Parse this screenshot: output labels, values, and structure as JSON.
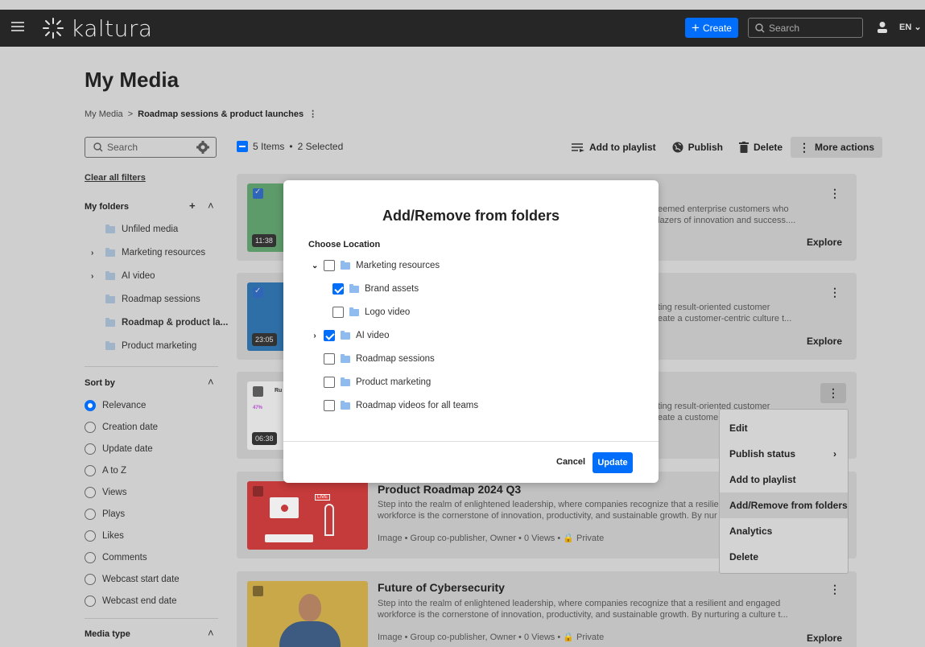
{
  "app": {
    "brand": "kaltura",
    "create_label": "Create",
    "search_placeholder": "Search",
    "language": "EN"
  },
  "page": {
    "title": "My Media"
  },
  "breadcrumb": {
    "root": "My Media",
    "separator": ">",
    "current": "Roadmap sessions & product launches",
    "menu": "⋮"
  },
  "toolbar": {
    "search_placeholder": "Search",
    "items_count": "5 Items",
    "bullet": "•",
    "selected": "2 Selected",
    "add_to_playlist": "Add to playlist",
    "publish": "Publish",
    "delete": "Delete",
    "more_actions": "More actions"
  },
  "sidebar": {
    "clear_filters": "Clear all filters",
    "my_folders": "My folders",
    "folders": [
      {
        "label": "Unfiled media",
        "expandable": false,
        "bold": false
      },
      {
        "label": "Marketing resources",
        "expandable": true,
        "bold": false
      },
      {
        "label": "AI video",
        "expandable": true,
        "bold": false
      },
      {
        "label": "Roadmap sessions",
        "expandable": false,
        "bold": false
      },
      {
        "label": "Roadmap & product la...",
        "expandable": false,
        "bold": true
      },
      {
        "label": "Product marketing",
        "expandable": false,
        "bold": false
      }
    ],
    "sort_by": "Sort by",
    "sort_options": [
      "Relevance",
      "Creation date",
      "Update date",
      "A to Z",
      "Views",
      "Plays",
      "Likes",
      "Comments",
      "Webcast start date",
      "Webcast end date"
    ],
    "sort_selected": "Relevance",
    "media_type": "Media type"
  },
  "cards": [
    {
      "duration": "11:38",
      "checked": true,
      "desc_line1": "eemed enterprise customers who",
      "desc_line2": "lazers of innovation and success....",
      "explore": "Explore",
      "thumb_color": "#5e9b6a"
    },
    {
      "duration": "23:05",
      "checked": true,
      "desc_line1": "ting result-oriented customer",
      "desc_line2": "eate a customer-centric culture t...",
      "explore": "Explore",
      "thumb_color": "#2f6fa8"
    },
    {
      "duration": "06:38",
      "checked": false,
      "desc_line1": "ting result-oriented customer",
      "desc_line2": "eate a custome",
      "explore": "",
      "thumb_color": "#e8e8e8",
      "thumb_label": "Ru",
      "thumb_stat": "47%"
    },
    {
      "title": "Product Roadmap 2024 Q3",
      "desc_line1": "Step into the realm of enlightened leadership, where companies recognize that a resilier",
      "desc_line2": "workforce is the cornerstone of innovation, productivity, and sustainable growth. By nur",
      "meta": "Image  •  Group co-publisher, Owner  •  0 Views  •  🔒 Private",
      "thumb_color": "#c53a3a",
      "thumb_badge": "LIVE"
    },
    {
      "title": "Future of Cybersecurity",
      "desc_line1": "Step into the realm of enlightened leadership, where companies recognize that a resilient and engaged",
      "desc_line2": "workforce is the cornerstone of innovation, productivity, and sustainable growth. By nurturing a culture t...",
      "meta": "Image  •  Group co-publisher, Owner  •  0 Views  •  🔒 Private",
      "explore": "Explore",
      "thumb_color": "#c9a84a"
    }
  ],
  "context_menu": {
    "items": [
      "Edit",
      "Publish status",
      "Add to playlist",
      "Add/Remove from folders",
      "Analytics",
      "Delete"
    ],
    "highlighted": "Add/Remove from folders"
  },
  "modal": {
    "title": "Add/Remove from folders",
    "subtitle": "Choose Location",
    "tree": [
      {
        "label": "Marketing resources",
        "level": 0,
        "chevron": "expanded",
        "checked": false
      },
      {
        "label": "Brand assets",
        "level": 1,
        "chevron": "none",
        "checked": true
      },
      {
        "label": "Logo video",
        "level": 1,
        "chevron": "none",
        "checked": false
      },
      {
        "label": "AI video",
        "level": 0,
        "chevron": "collapsed",
        "checked": true
      },
      {
        "label": "Roadmap sessions",
        "level": 0,
        "chevron": "none",
        "checked": false
      },
      {
        "label": "Product marketing",
        "level": 0,
        "chevron": "none",
        "checked": false
      },
      {
        "label": "Roadmap videos for all teams",
        "level": 0,
        "chevron": "none",
        "checked": false
      }
    ],
    "cancel": "Cancel",
    "update": "Update"
  },
  "colors": {
    "accent": "#006efa",
    "topbar": "#262626",
    "overlay_bg": "#cfcfcf"
  }
}
